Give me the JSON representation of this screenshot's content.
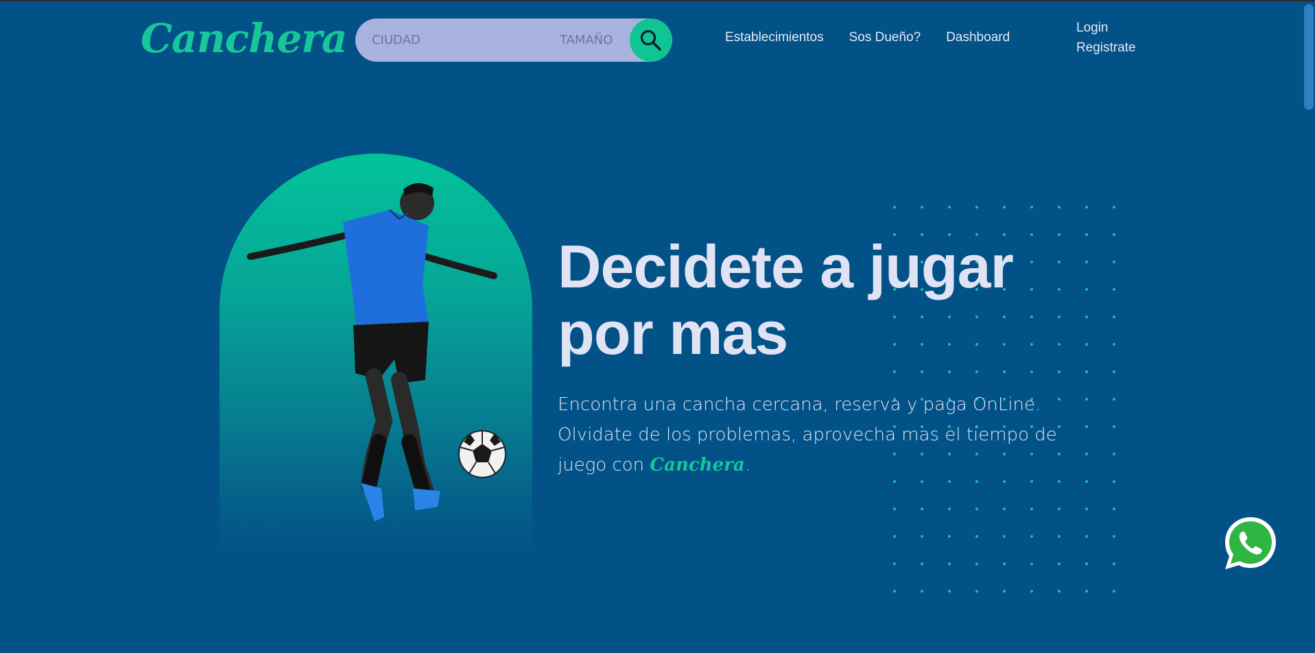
{
  "header": {
    "logo_text": "Canchera",
    "search": {
      "city_placeholder": "CIUDAD",
      "size_label": "TAMAÑO",
      "search_icon": "search-icon"
    },
    "nav": [
      {
        "label": "Establecimientos"
      },
      {
        "label": "Sos Dueño?"
      },
      {
        "label": "Dashboard"
      }
    ],
    "auth": {
      "login": "Login",
      "register": "Registrate"
    }
  },
  "hero": {
    "title_line1": "Decidete a jugar",
    "title_line2": "por mas",
    "text_part1": "Encontra una cancha cercana, reserva y paga OnLine. Olvidate de los problemas, aprovecha mas el tiempo de juego con ",
    "brand": "Canchera",
    "text_end": ".",
    "image": "soccer-player-kicking-ball"
  },
  "floating": {
    "whatsapp_icon": "whatsapp-icon"
  },
  "colors": {
    "background": "#025187",
    "accent": "#17c79a",
    "search_bg": "#a9b3df",
    "text_light": "#dfe3f4"
  }
}
